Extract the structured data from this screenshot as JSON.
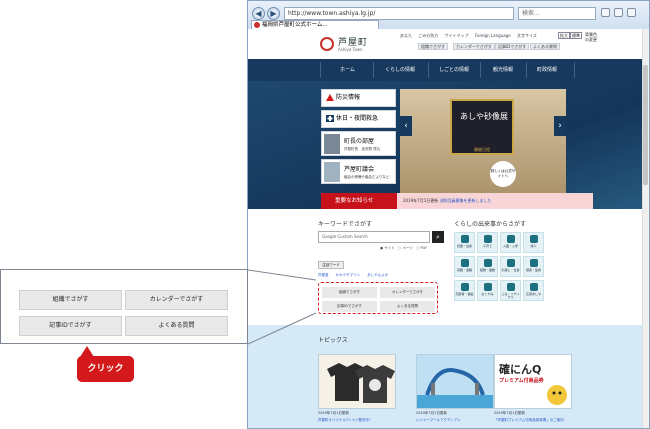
{
  "browser": {
    "address": "http://www.town.ashiya.lg.jp/",
    "search_placeholder": "検索...",
    "tab_title": "福岡県芦屋町公式ホーム..."
  },
  "site": {
    "name": "芦屋町",
    "name_en": "Ashiya Town",
    "header_links": [
      "あなた",
      "ごみ分別方",
      "サイトマップ",
      "Foreign Language",
      "文字サイズ"
    ],
    "size_btns": [
      "拡大",
      "標準"
    ],
    "color_label": "背景色の変更",
    "ctrl_btns": [
      "組織でさがす",
      "カレンダーでさがす",
      "記事IDでさがす",
      "よくある質問"
    ]
  },
  "gnav": [
    "ホーム",
    "くらしの情報",
    "しごとの情報",
    "観光情報",
    "町政情報"
  ],
  "side": {
    "disaster": "防災情報",
    "holiday": "休日・夜間救急",
    "mayor": "町長の部屋",
    "mayor_sub": "芦屋町長　波多野 茂丸",
    "council": "芦屋町議会",
    "council_sub": "議会の傍聴や議会だよりなど"
  },
  "slide": {
    "title": "あしや砂像展",
    "date": "開催日程",
    "badge": "詳しくは公式サイトへ"
  },
  "alert": {
    "label": "重要なお知らせ",
    "text": "2019年7月1日更新",
    "link": "消防団員募集を更新しました"
  },
  "keyword": {
    "heading": "キーワードでさがす",
    "input": "Google Custom Search",
    "radios": "● サイト　○ ページ　○ PDF",
    "tag": "注目ワード",
    "links": [
      "芦屋釜",
      "かわうそマリン",
      "あしやんよか"
    ],
    "buttons": [
      "組織でさがす",
      "カレンダーでさがす",
      "記事IDでさがす",
      "よくある質問"
    ]
  },
  "life": {
    "heading": "くらしの出来事からさがす",
    "items": [
      "妊娠・出産",
      "子育て",
      "入園・入学",
      "成人",
      "就職・退職",
      "結婚・離婚",
      "引越し・住替",
      "健康・医療",
      "高齢者・福祉",
      "おくやみ",
      "ごみ・リサイクル",
      "広報あしや"
    ]
  },
  "topics": {
    "heading": "トピックス",
    "cards": [
      {
        "date": "2019年7月1日更新",
        "title": "芦屋町オリジナルTシャツ販売中！"
      },
      {
        "date": "2019年7月1日更新",
        "title": "レジャープールアクアシアン"
      },
      {
        "date": "2019年7月1日更新",
        "title": "「芦屋町プレミアム付商品券事業」のご案内"
      }
    ],
    "card3_big": "確にんQ",
    "card3_sub": "プレミアム付商品券"
  },
  "callout": {
    "buttons": [
      "組織でさがす",
      "カレンダーでさがす",
      "記事IDでさがす",
      "よくある質問"
    ]
  },
  "click_label": "クリック",
  "colors": {
    "navy": "#17395d",
    "alert": "#c8121b",
    "accent": "#d3191b"
  }
}
